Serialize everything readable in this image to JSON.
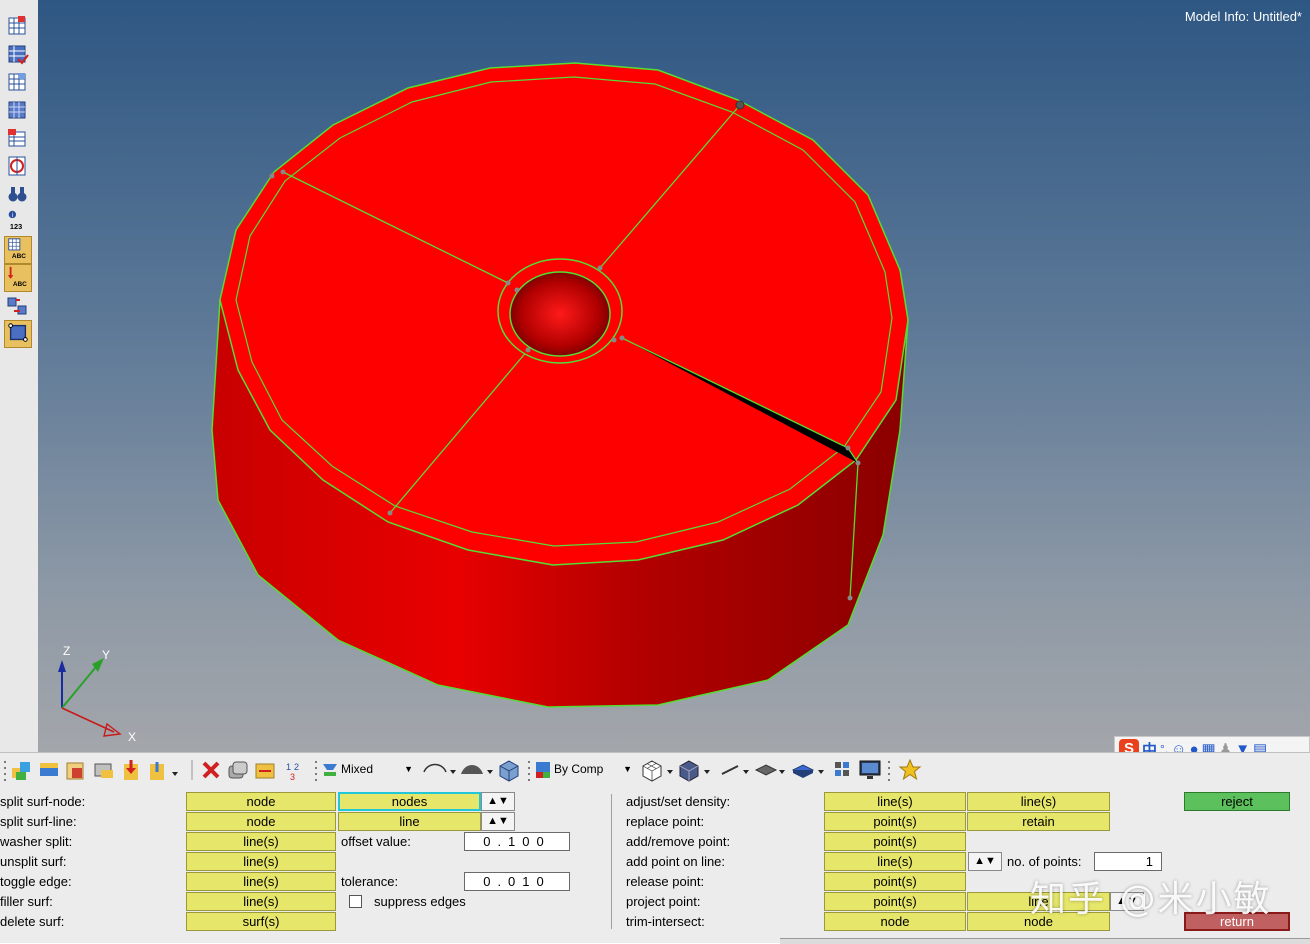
{
  "viewport": {
    "model_info": "Model Info: Untitled*"
  },
  "axes": {
    "z": "Z",
    "y": "Y",
    "x": "X"
  },
  "left_toolbar": {
    "icons": [
      "display-panel-icon",
      "mask-panel-icon",
      "find-icon",
      "shade-icon",
      "reverse-view-icon",
      "circle-icon",
      "binoculars-icon",
      "numbers-icon",
      "abc-icon",
      "abc-arrow-icon",
      "flip-icon",
      "select-box-icon"
    ],
    "numbers_label": "123",
    "abc_label": "ABC"
  },
  "bottom_toolbar": {
    "display_mode": "Mixed",
    "color_mode": "By Comp"
  },
  "ime": {
    "lang": "中",
    "punct": "°,"
  },
  "panel": {
    "rows_left": [
      {
        "label": "split surf-node:",
        "btn1": "node",
        "btn2": "nodes"
      },
      {
        "label": "split surf-line:",
        "btn1": "node",
        "btn2": "line"
      },
      {
        "label": "washer split:",
        "btn1": "line(s)",
        "extra_label": "offset value:",
        "field": "0.100"
      },
      {
        "label": "unsplit surf:",
        "btn1": "line(s)"
      },
      {
        "label": "toggle edge:",
        "btn1": "line(s)",
        "extra_label": "tolerance:",
        "field": "0.010"
      },
      {
        "label": "filler surf:",
        "btn1": "line(s)",
        "extra_label": "suppress edges"
      },
      {
        "label": "delete surf:",
        "btn1": "surf(s)"
      }
    ],
    "rows_right": [
      {
        "label": "adjust/set density:",
        "btn1": "line(s)",
        "btn2": "line(s)"
      },
      {
        "label": "replace point:",
        "btn1": "point(s)",
        "btn2": "retain"
      },
      {
        "label": "add/remove point:",
        "btn1": "point(s)"
      },
      {
        "label": "add point on line:",
        "btn1": "line(s)",
        "extra_label": "no. of points:",
        "field": "1"
      },
      {
        "label": "release point:",
        "btn1": "point(s)"
      },
      {
        "label": "project point:",
        "btn1": "point(s)",
        "btn2": "line"
      },
      {
        "label": "trim-intersect:",
        "btn1": "node",
        "btn2": "node"
      }
    ],
    "reject": "reject",
    "return": "return"
  },
  "watermark": "知乎 @米小敏",
  "colors": {
    "model": "#ff0000",
    "edge": "#55dd33",
    "button": "#e6e66a",
    "reject": "#5cc05c",
    "return": "#c06060"
  }
}
